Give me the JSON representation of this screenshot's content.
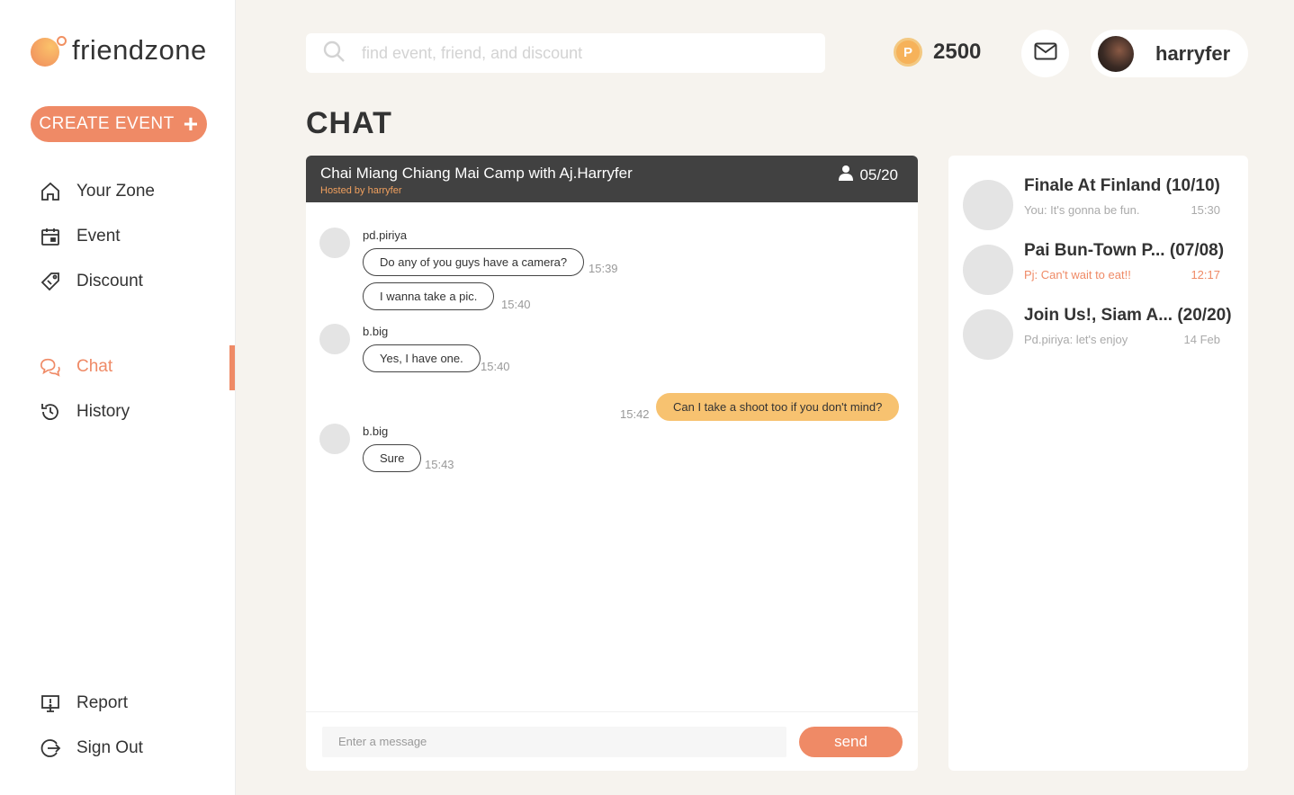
{
  "app": {
    "name": "friendzone",
    "create_event_label": "CREATE EVENT",
    "create_event_icon": "plus-icon",
    "accent_color": "#ef8a66"
  },
  "sidebar": {
    "items": [
      {
        "label": "Your Zone",
        "icon": "home-icon"
      },
      {
        "label": "Event",
        "icon": "calendar-icon"
      },
      {
        "label": "Discount",
        "icon": "tag-icon"
      },
      {
        "label": "Chat",
        "icon": "chat-bubbles-icon",
        "active": true
      },
      {
        "label": "History",
        "icon": "history-icon"
      }
    ],
    "bottom_items": [
      {
        "label": "Report",
        "icon": "monitor-alert-icon"
      },
      {
        "label": "Sign Out",
        "icon": "sign-out-icon"
      }
    ]
  },
  "header": {
    "search_placeholder": "find event, friend, and discount",
    "points_symbol": "P",
    "points": "2500",
    "username": "harryfer"
  },
  "page": {
    "title": "CHAT"
  },
  "chat": {
    "title": "Chai Miang Chiang Mai Camp with Aj.Harryfer",
    "host": "Hosted by harryfer",
    "participants": "05/20",
    "groups": [
      {
        "user": "pd.piriya",
        "messages": [
          {
            "text": "Do any of you guys have a camera?",
            "time": "15:39"
          },
          {
            "text": "I wanna take a pic.",
            "time": "15:40"
          }
        ]
      },
      {
        "user": "b.big",
        "messages": [
          {
            "text": "Yes, I have one.",
            "time": "15:40"
          }
        ]
      },
      {
        "mine": true,
        "messages": [
          {
            "text": "Can I take a shoot too if you don't mind?",
            "time": "15:42"
          }
        ]
      },
      {
        "user": "b.big",
        "messages": [
          {
            "text": "Sure",
            "time": "15:43"
          }
        ]
      }
    ],
    "input_placeholder": "Enter a message",
    "send_label": "send"
  },
  "conversations": [
    {
      "title": "Finale At Finland (10/10)",
      "preview": "You: It's gonna be fun.",
      "time": "15:30",
      "unread": false
    },
    {
      "title": "Pai Bun-Town P... (07/08)",
      "preview": "Pj: Can't wait to eat!!",
      "time": "12:17",
      "unread": true
    },
    {
      "title": "Join Us!, Siam A... (20/20)",
      "preview": "Pd.piriya: let's enjoy",
      "time": "14 Feb",
      "unread": false
    }
  ]
}
